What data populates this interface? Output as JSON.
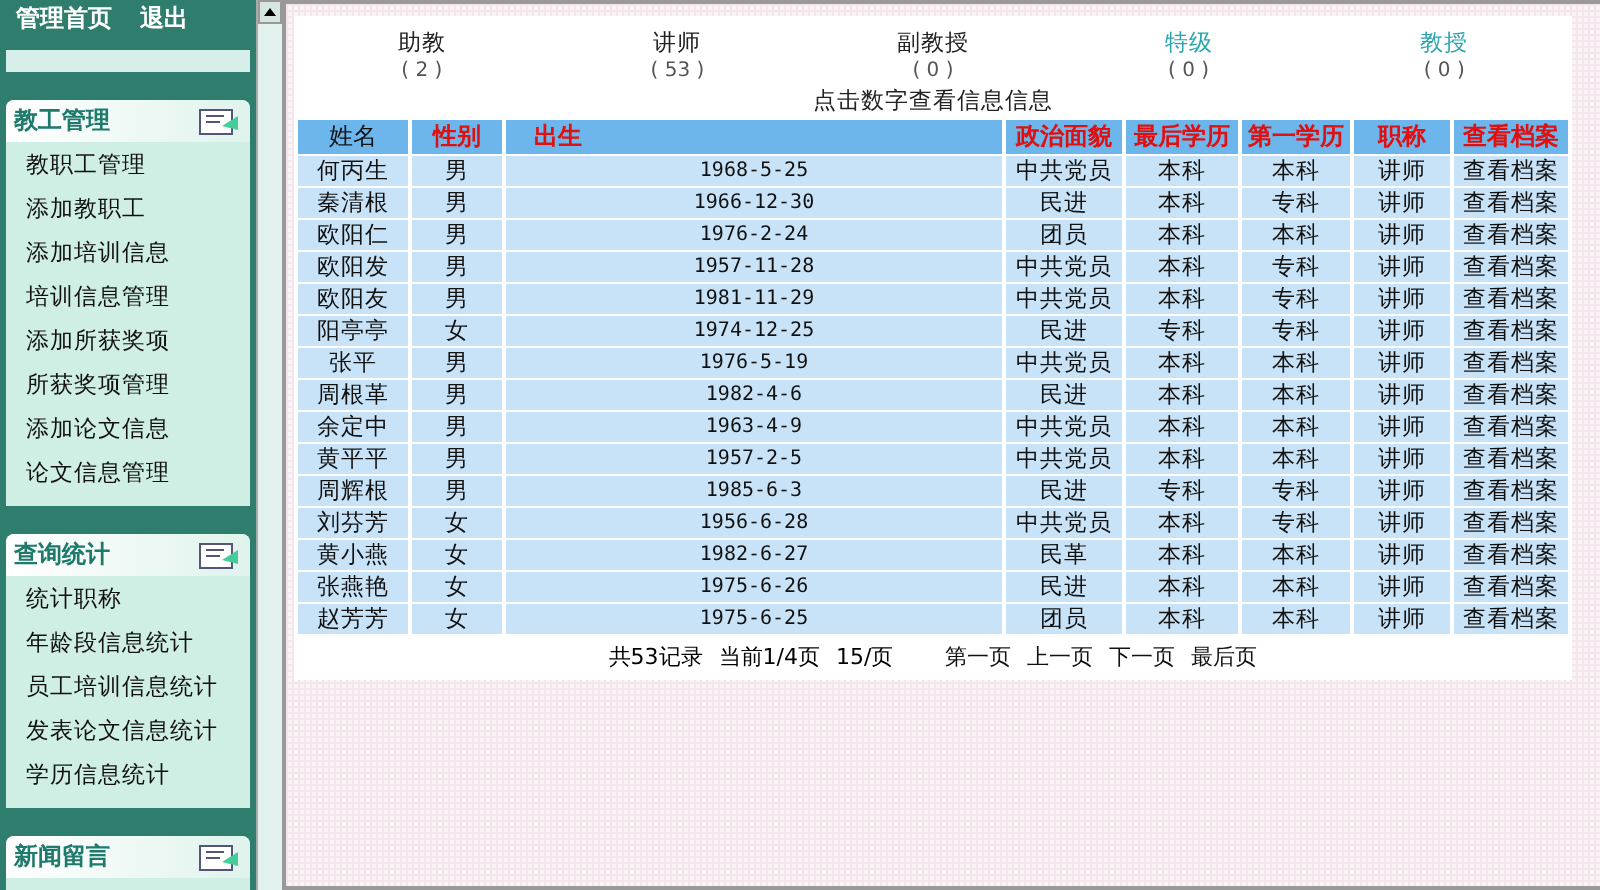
{
  "top_bar": {
    "links": [
      "管理首页",
      "退出"
    ]
  },
  "sidebar": {
    "sections": [
      {
        "title": "教工管理",
        "items": [
          "教职工管理",
          "添加教职工",
          "添加培训信息",
          "培训信息管理",
          "添加所获奖项",
          "所获奖项管理",
          "添加论文信息",
          "论文信息管理"
        ]
      },
      {
        "title": "查询统计",
        "items": [
          "统计职称",
          "年龄段信息统计",
          "员工培训信息统计",
          "发表论文信息统计",
          "学历信息统计"
        ]
      },
      {
        "title": "新闻留言"
      }
    ]
  },
  "stats": [
    {
      "label": "助教",
      "count": "( 2 )",
      "highlighted": false
    },
    {
      "label": "讲师",
      "count": "( 53 )",
      "highlighted": false
    },
    {
      "label": "副教授",
      "count": "( 0 )",
      "highlighted": false
    },
    {
      "label": "特级",
      "count": "( 0 )",
      "highlighted": true
    },
    {
      "label": "教授",
      "count": "( 0 )",
      "highlighted": true
    }
  ],
  "hint": "点击数字查看信息信息",
  "table": {
    "columns": [
      {
        "label": "姓名",
        "highlighted": false
      },
      {
        "label": "性别",
        "highlighted": true
      },
      {
        "label": "出生",
        "highlighted": true
      },
      {
        "label": "政治面貌",
        "highlighted": true
      },
      {
        "label": "最后学历",
        "highlighted": true
      },
      {
        "label": "第一学历",
        "highlighted": true
      },
      {
        "label": "职称",
        "highlighted": true
      },
      {
        "label": "查看档案",
        "highlighted": true
      }
    ],
    "rows": [
      [
        "何丙生",
        "男",
        "1968-5-25",
        "中共党员",
        "本科",
        "本科",
        "讲师",
        "查看档案"
      ],
      [
        "秦清根",
        "男",
        "1966-12-30",
        "民进",
        "本科",
        "专科",
        "讲师",
        "查看档案"
      ],
      [
        "欧阳仁",
        "男",
        "1976-2-24",
        "团员",
        "本科",
        "本科",
        "讲师",
        "查看档案"
      ],
      [
        "欧阳发",
        "男",
        "1957-11-28",
        "中共党员",
        "本科",
        "专科",
        "讲师",
        "查看档案"
      ],
      [
        "欧阳友",
        "男",
        "1981-11-29",
        "中共党员",
        "本科",
        "专科",
        "讲师",
        "查看档案"
      ],
      [
        "阳亭亭",
        "女",
        "1974-12-25",
        "民进",
        "专科",
        "专科",
        "讲师",
        "查看档案"
      ],
      [
        "张平",
        "男",
        "1976-5-19",
        "中共党员",
        "本科",
        "本科",
        "讲师",
        "查看档案"
      ],
      [
        "周根革",
        "男",
        "1982-4-6",
        "民进",
        "本科",
        "本科",
        "讲师",
        "查看档案"
      ],
      [
        "余定中",
        "男",
        "1963-4-9",
        "中共党员",
        "本科",
        "本科",
        "讲师",
        "查看档案"
      ],
      [
        "黄平平",
        "男",
        "1957-2-5",
        "中共党员",
        "本科",
        "本科",
        "讲师",
        "查看档案"
      ],
      [
        "周辉根",
        "男",
        "1985-6-3",
        "民进",
        "专科",
        "专科",
        "讲师",
        "查看档案"
      ],
      [
        "刘芬芳",
        "女",
        "1956-6-28",
        "中共党员",
        "本科",
        "专科",
        "讲师",
        "查看档案"
      ],
      [
        "黄小燕",
        "女",
        "1982-6-27",
        "民革",
        "本科",
        "本科",
        "讲师",
        "查看档案"
      ],
      [
        "张燕艳",
        "女",
        "1975-6-26",
        "民进",
        "本科",
        "本科",
        "讲师",
        "查看档案"
      ],
      [
        "赵芳芳",
        "女",
        "1975-6-25",
        "团员",
        "本科",
        "本科",
        "讲师",
        "查看档案"
      ]
    ]
  },
  "pagination": {
    "summary": [
      "共53记录",
      "当前1/4页",
      "15/页"
    ],
    "links": [
      "第一页",
      "上一页",
      "下一页",
      "最后页"
    ]
  }
}
